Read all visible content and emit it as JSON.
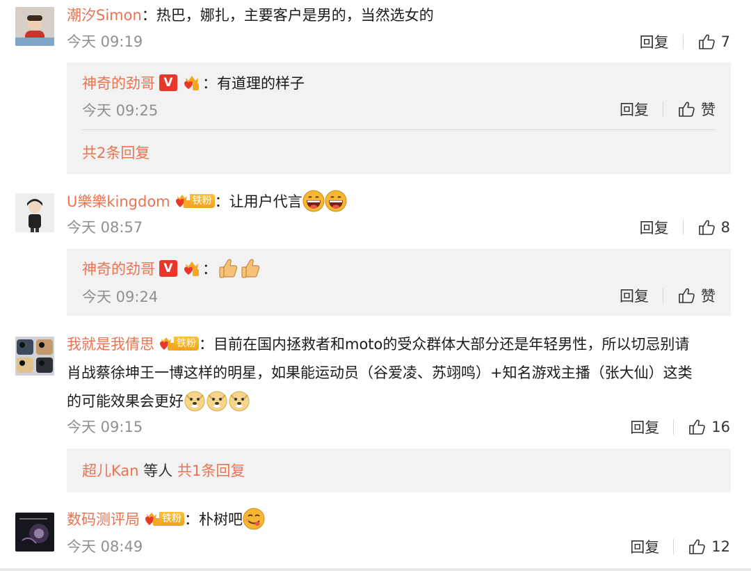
{
  "comments": [
    {
      "user": "潮汐Simon",
      "text": "：热巴，娜扎，主要客户是男的，当然选女的",
      "time": "今天 09:19",
      "reply_label": "回复",
      "likes": "7",
      "sub": {
        "user": "神奇的劲哥",
        "badge_v": "V",
        "text": "：有道理的样子",
        "time": "今天 09:25",
        "reply_label": "回复",
        "like_label": "赞",
        "more": "共2条回复"
      }
    },
    {
      "user": "U樂樂kingdom",
      "fan_badge": "铁粉",
      "text": "：让用户代言",
      "time": "今天 08:57",
      "reply_label": "回复",
      "likes": "8",
      "sub": {
        "user": "神奇的劲哥",
        "badge_v": "V",
        "text": "：",
        "time": "今天 09:24",
        "reply_label": "回复",
        "like_label": "赞"
      }
    },
    {
      "user": "我就是我倩思",
      "fan_badge": "铁粉",
      "text_line1": "：目前在国内拯救者和moto的受众群体大部分还是年轻男性，所以切忌别请",
      "text_line2": "肖战蔡徐坤王一博这样的明星，如果能运动员（谷爱凌、苏翊鸣）+知名游戏主播（张大仙）这类",
      "text_line3": "的可能效果会更好",
      "time": "今天 09:15",
      "reply_label": "回复",
      "likes": "16",
      "more_user": "超儿Kan",
      "more_mid": " 等人 ",
      "more": "共1条回复"
    },
    {
      "user": "数码测评局",
      "fan_badge": "铁粉",
      "text": "：朴树吧",
      "time": "今天 08:49",
      "reply_label": "回复",
      "likes": "12"
    }
  ],
  "colors": {
    "username": "#eb7350",
    "time": "#909090",
    "sub_bg": "#f2f2f2"
  },
  "icons": [
    "thumb-up-icon",
    "crown-icon",
    "v-badge-icon",
    "fan-heart-icon",
    "grin-emoji",
    "thumbs-emoji",
    "doge-emoji",
    "yum-emoji"
  ]
}
